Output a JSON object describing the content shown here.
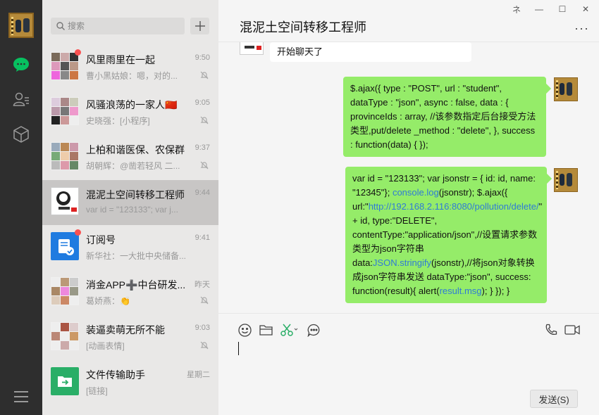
{
  "search": {
    "placeholder": "搜索"
  },
  "chats": [
    {
      "name": "风里雨里在一起",
      "time": "9:50",
      "preview": "曹小黑姑娘：嗯，对的...",
      "unread": true,
      "muted": true
    },
    {
      "name": "风骚浪荡的一家人🇨🇳",
      "time": "9:05",
      "preview": "史晓强：[小程序]",
      "unread": false,
      "muted": true
    },
    {
      "name": "上柏和谐医保、农保群",
      "time": "9:37",
      "preview": "胡朝辉：@凿若轻风 二...",
      "unread": false,
      "muted": true
    },
    {
      "name": "混泥土空间转移工程师",
      "time": "9:44",
      "preview": "var id = \"123133\"; var j...",
      "unread": false,
      "muted": false
    },
    {
      "name": "订阅号",
      "time": "9:41",
      "preview": "新华社：一大批中央储备...",
      "unread": true,
      "muted": false
    },
    {
      "name": "消金APP➕中台研发...",
      "time": "昨天",
      "preview": "葛娇燕：👏",
      "unread": false,
      "muted": true
    },
    {
      "name": "装逼卖萌无所不能",
      "time": "9:03",
      "preview": "[动画表情]",
      "unread": false,
      "muted": true
    },
    {
      "name": "文件传输助手",
      "time": "星期二",
      "preview": "[链接]",
      "unread": false,
      "muted": false
    }
  ],
  "window": {
    "pin": "ネ",
    "minimize": "—",
    "maximize": "☐",
    "close": "✕"
  },
  "chat_title": "混泥土空间转移工程师",
  "more_label": "···",
  "messages": {
    "prev_top": "开始聊天了",
    "msg1": "$.ajax({ type : \"POST\", url : \"student\", dataType : \"json\", async : false, data : { provinceIds : array, //该参数指定后台接受方法类型,put/delete _method : \"delete\", }, success : function(data) { });",
    "msg2": {
      "p1": "var id = \"123133\"; var jsonstr = { id: id, name: \"12345\"}; ",
      "l1": "console.log",
      "p2": "(jsonstr); $.ajax({ url:\"",
      "l2": "http://192.168.2.116:8080/pollution/delete/",
      "p3": "\" + id, type:\"DELETE\", contentType:\"application/json\",//设置请求参数类型为json字符串 data:",
      "l3": "JSON.stringify",
      "p4": "(jsonstr),//将json对象转换成json字符串发送 dataType:\"json\", success: function(result){ alert(",
      "l4": "result.msg",
      "p5": "); } }); }"
    }
  },
  "send_label": "发送(S)"
}
